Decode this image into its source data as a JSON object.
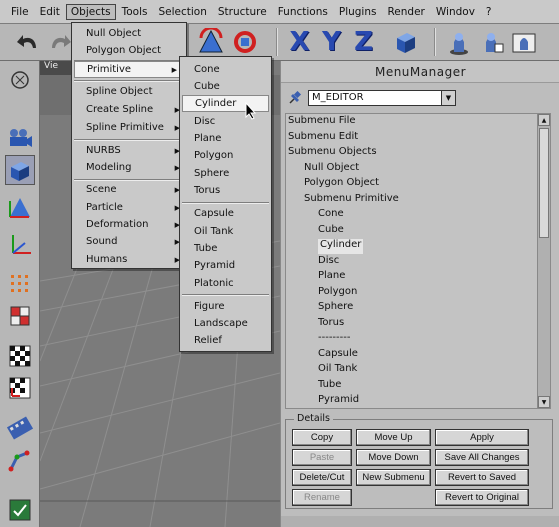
{
  "menubar": [
    "File",
    "Edit",
    "Objects",
    "Tools",
    "Selection",
    "Structure",
    "Functions",
    "Plugins",
    "Render",
    "Windov",
    "?"
  ],
  "objects_menu": {
    "items": [
      {
        "label": "Null Object",
        "arrow": false
      },
      {
        "label": "Polygon Object",
        "arrow": false
      },
      {
        "label": "Primitive",
        "arrow": true
      },
      {
        "label": "Spline Object",
        "arrow": false
      },
      {
        "label": "Create Spline",
        "arrow": true
      },
      {
        "label": "Spline Primitive",
        "arrow": true
      },
      {
        "label": "NURBS",
        "arrow": true
      },
      {
        "label": "Modeling",
        "arrow": true
      },
      {
        "label": "Scene",
        "arrow": true
      },
      {
        "label": "Particle",
        "arrow": true
      },
      {
        "label": "Deformation",
        "arrow": true
      },
      {
        "label": "Sound",
        "arrow": true
      },
      {
        "label": "Humans",
        "arrow": true
      }
    ]
  },
  "primitive_menu": {
    "items": [
      "Cone",
      "Cube",
      "Cylinder",
      "Disc",
      "Plane",
      "Polygon",
      "Sphere",
      "Torus",
      "Capsule",
      "Oil Tank",
      "Tube",
      "Pyramid",
      "Platonic",
      "Figure",
      "Landscape",
      "Relief"
    ],
    "highlighted": "Cylinder"
  },
  "viewport": {
    "tab_label": "Vie"
  },
  "menu_manager": {
    "title": "MenuManager",
    "selector_value": "M_EDITOR",
    "tree": [
      {
        "label": "Submenu File",
        "indent": 0
      },
      {
        "label": "Submenu Edit",
        "indent": 0
      },
      {
        "label": "Submenu Objects",
        "indent": 0
      },
      {
        "label": "Null Object",
        "indent": 1
      },
      {
        "label": "Polygon Object",
        "indent": 1
      },
      {
        "label": "Submenu Primitive",
        "indent": 1
      },
      {
        "label": "Cone",
        "indent": 2
      },
      {
        "label": "Cube",
        "indent": 2
      },
      {
        "label": "Cylinder",
        "indent": 2,
        "selected": true
      },
      {
        "label": "Disc",
        "indent": 2
      },
      {
        "label": "Plane",
        "indent": 2
      },
      {
        "label": "Polygon",
        "indent": 2
      },
      {
        "label": "Sphere",
        "indent": 2
      },
      {
        "label": "Torus",
        "indent": 2
      },
      {
        "label": "---------",
        "indent": 2
      },
      {
        "label": "Capsule",
        "indent": 2
      },
      {
        "label": "Oil Tank",
        "indent": 2
      },
      {
        "label": "Tube",
        "indent": 2
      },
      {
        "label": "Pyramid",
        "indent": 2
      }
    ],
    "details_label": "Details",
    "buttons": {
      "copy": "Copy",
      "move_up": "Move Up",
      "apply": "Apply",
      "paste": "Paste",
      "move_down": "Move Down",
      "save_all": "Save All Changes",
      "delete_cut": "Delete/Cut",
      "new_submenu": "New Submenu",
      "revert_saved": "Revert to Saved",
      "rename": "Rename",
      "revert_original": "Revert to Original"
    },
    "disabled_buttons": [
      "paste",
      "rename"
    ]
  },
  "toolbar": {
    "axis_labels": [
      "X",
      "Y",
      "Z"
    ]
  },
  "colors": {
    "menu_highlight": "#3d5fa8",
    "axis_blue": "#2849b0"
  }
}
